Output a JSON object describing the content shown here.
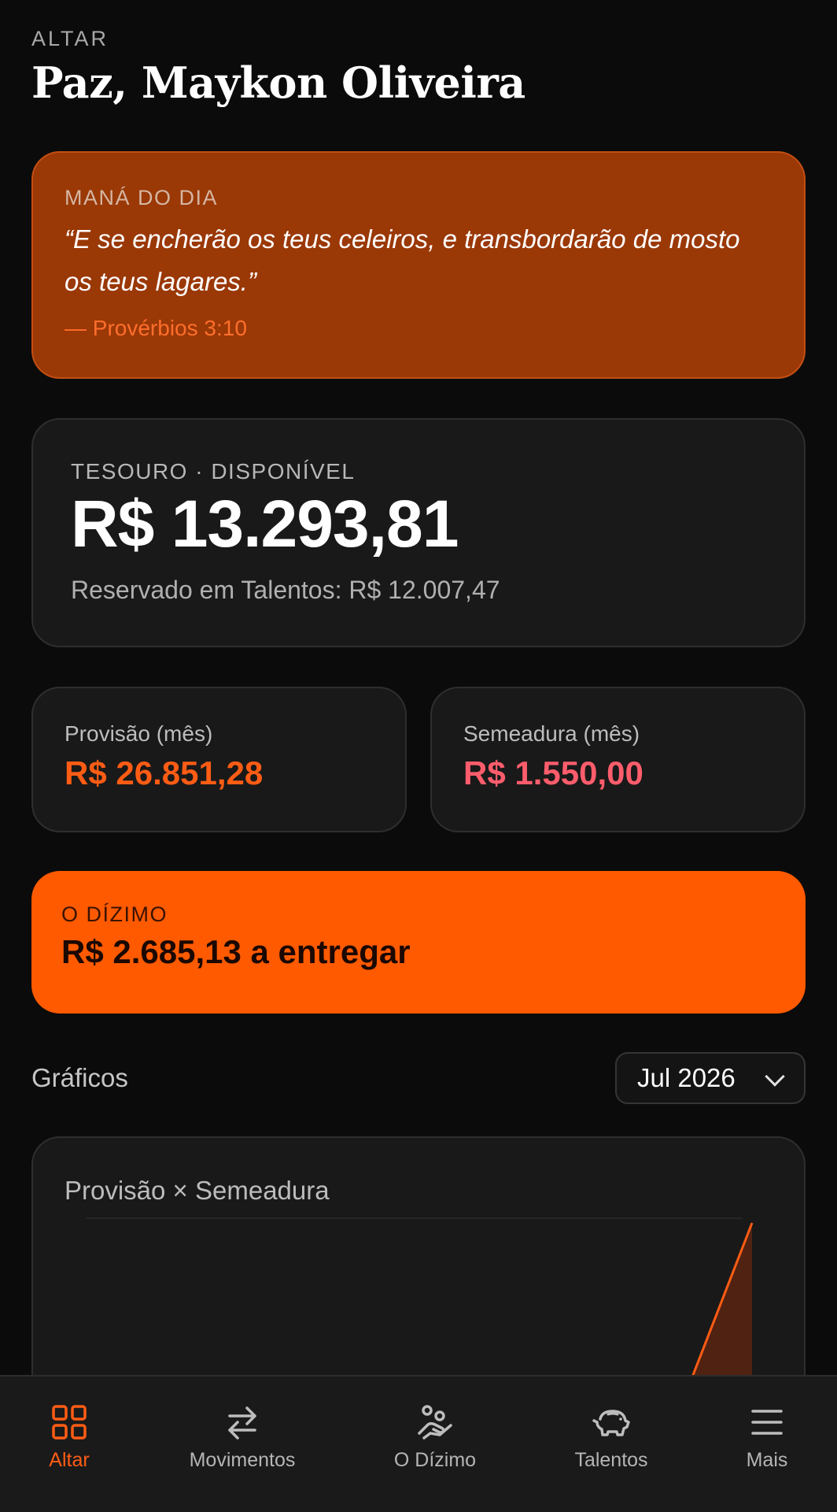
{
  "header": {
    "eyebrow": "ALTAR",
    "title": "Paz, Maykon Oliveira"
  },
  "verse": {
    "label": "MANÁ DO DIA",
    "text": "“E se encherão os teus celeiros, e transbordarão de mosto os teus lagares.”",
    "reference": "— Provérbios 3:10"
  },
  "balance": {
    "label": "TESOURO · DISPONÍVEL",
    "value": "R$ 13.293,81",
    "reserved": "Reservado em Talentos: R$ 12.007,47"
  },
  "stats": {
    "provision": {
      "label": "Provisão (mês)",
      "value": "R$ 26.851,28"
    },
    "sowing": {
      "label": "Semeadura (mês)",
      "value": "R$ 1.550,00"
    }
  },
  "tithe": {
    "label": "O DÍZIMO",
    "value": "R$ 2.685,13 a entregar"
  },
  "charts": {
    "title": "Gráficos",
    "month": "Jul 2026"
  },
  "chart_data": {
    "type": "area",
    "title": "Provisão × Semeadura",
    "series": [
      {
        "name": "Provisão",
        "values": [
          0,
          0,
          0,
          0,
          0,
          0,
          26851.28
        ]
      }
    ],
    "colors": {
      "Provisão": "#ff5c14"
    },
    "grid": true
  },
  "nav": {
    "items": [
      {
        "label": "Altar",
        "icon": "grid-icon",
        "active": true
      },
      {
        "label": "Movimentos",
        "icon": "transfer-arrows-icon"
      },
      {
        "label": "O Dízimo",
        "icon": "giving-hand-icon"
      },
      {
        "label": "Talentos",
        "icon": "piggy-bank-icon"
      },
      {
        "label": "Mais",
        "icon": "menu-icon"
      }
    ]
  },
  "colors": {
    "accent": "#ff5a00",
    "provision": "#ff5c14",
    "sowing": "#ff5d6c",
    "verse_bg": "#9a3806"
  }
}
